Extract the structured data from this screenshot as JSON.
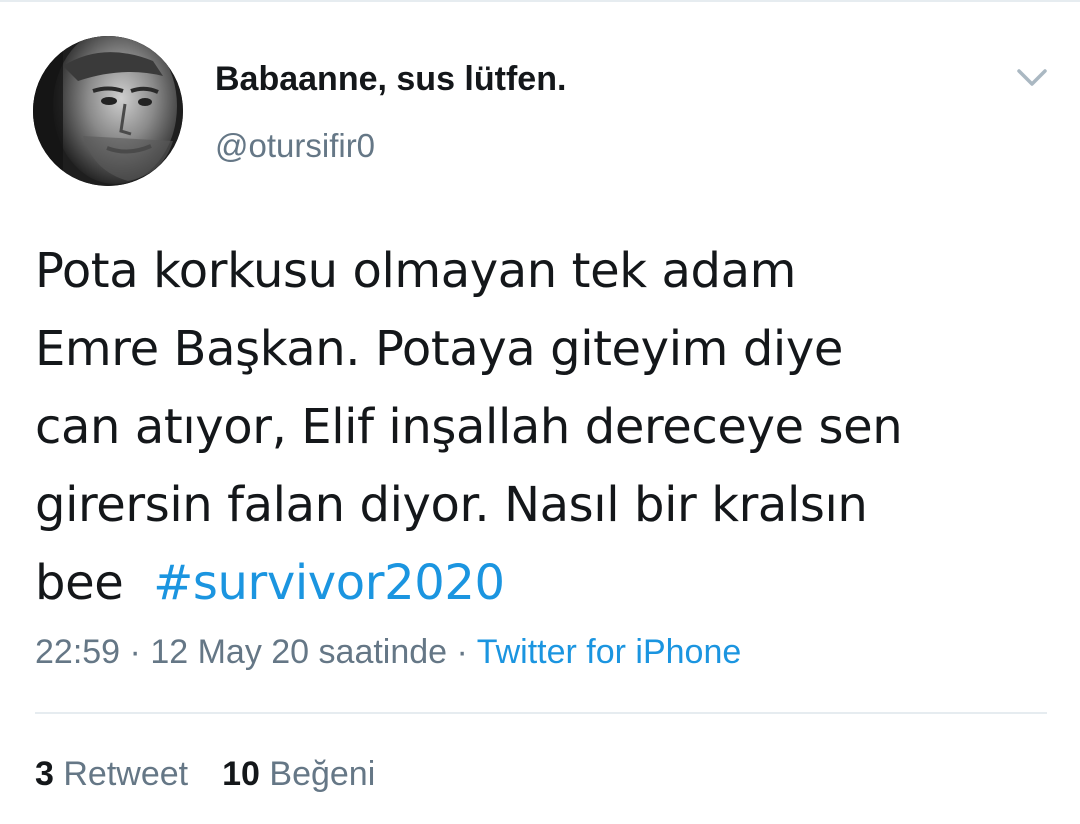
{
  "tweet": {
    "display_name": "Babaanne, sus lütfen.",
    "handle": "@otursifir0",
    "text_line_1": "Pota korkusu olmayan tek adam",
    "text_line_2": "Emre Başkan. Potaya giteyim diye",
    "text_line_3": "can atıyor, Elif inşallah dereceye sen",
    "text_line_4": "girersin falan diyor. Nasıl bir kralsın",
    "text_line_5": "bee",
    "hashtag": "#survivor2020",
    "time": "22:59",
    "date": "12 May 20 saatinde",
    "source": "Twitter for iPhone",
    "separator": "·"
  },
  "stats": {
    "retweet_count": "3",
    "retweet_label": "Retweet",
    "like_count": "10",
    "like_label": "Beğeni"
  },
  "icons": {
    "menu": "chevron-down-icon",
    "avatar": "profile-photo"
  },
  "colors": {
    "text": "#14171a",
    "secondary_text": "#657786",
    "link": "#1b95e0",
    "divider": "#e6ecf0",
    "background": "#ffffff"
  }
}
